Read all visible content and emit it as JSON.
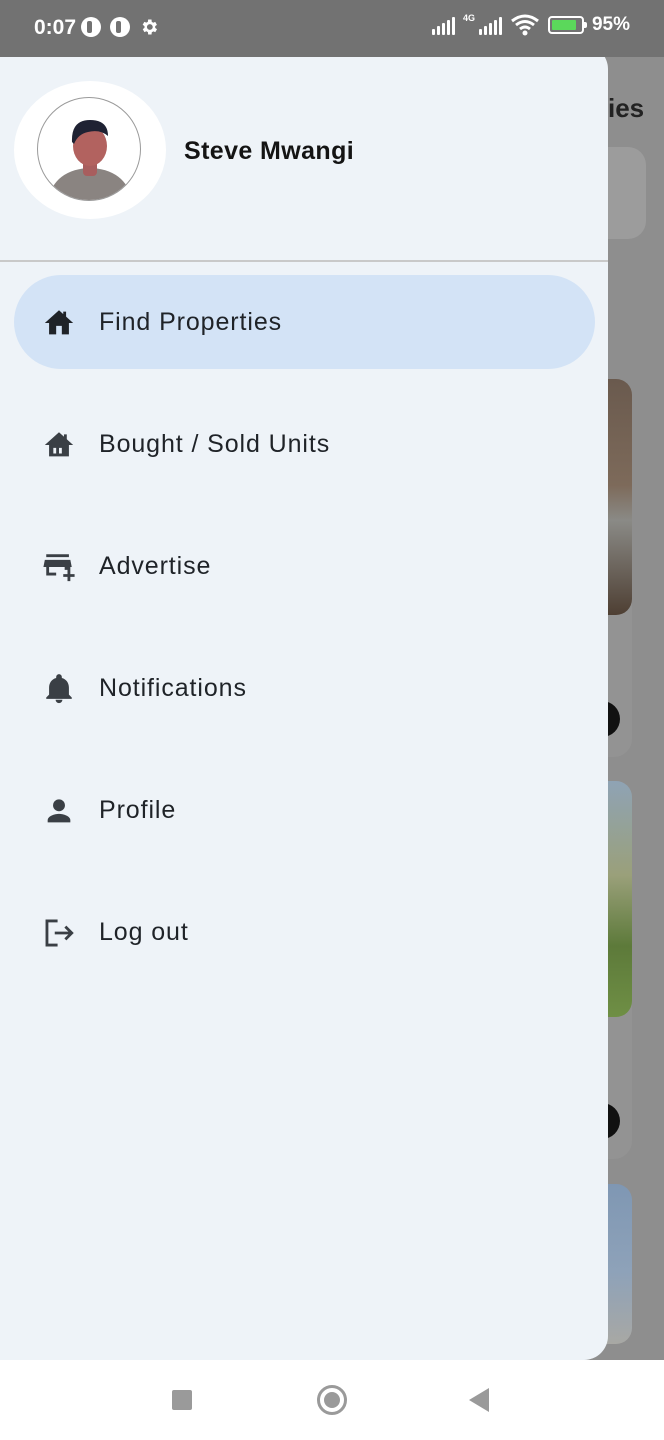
{
  "status_bar": {
    "time": "0:07",
    "network": "4G",
    "battery": "95%"
  },
  "background_page": {
    "title_fragment": "ies"
  },
  "drawer": {
    "user_name": "Steve Mwangi",
    "menu": [
      {
        "label": "Find Properties",
        "icon": "home-icon",
        "active": true
      },
      {
        "label": "Bought / Sold Units",
        "icon": "house-icon",
        "active": false
      },
      {
        "label": "Advertise",
        "icon": "add-business-icon",
        "active": false
      },
      {
        "label": "Notifications",
        "icon": "bell-icon",
        "active": false
      },
      {
        "label": "Profile",
        "icon": "person-icon",
        "active": false
      },
      {
        "label": "Log out",
        "icon": "logout-icon",
        "active": false
      }
    ]
  },
  "colors": {
    "drawer_bg": "#eef3f8",
    "active_item_bg": "#d3e3f6",
    "icon_color": "#1f2328"
  }
}
